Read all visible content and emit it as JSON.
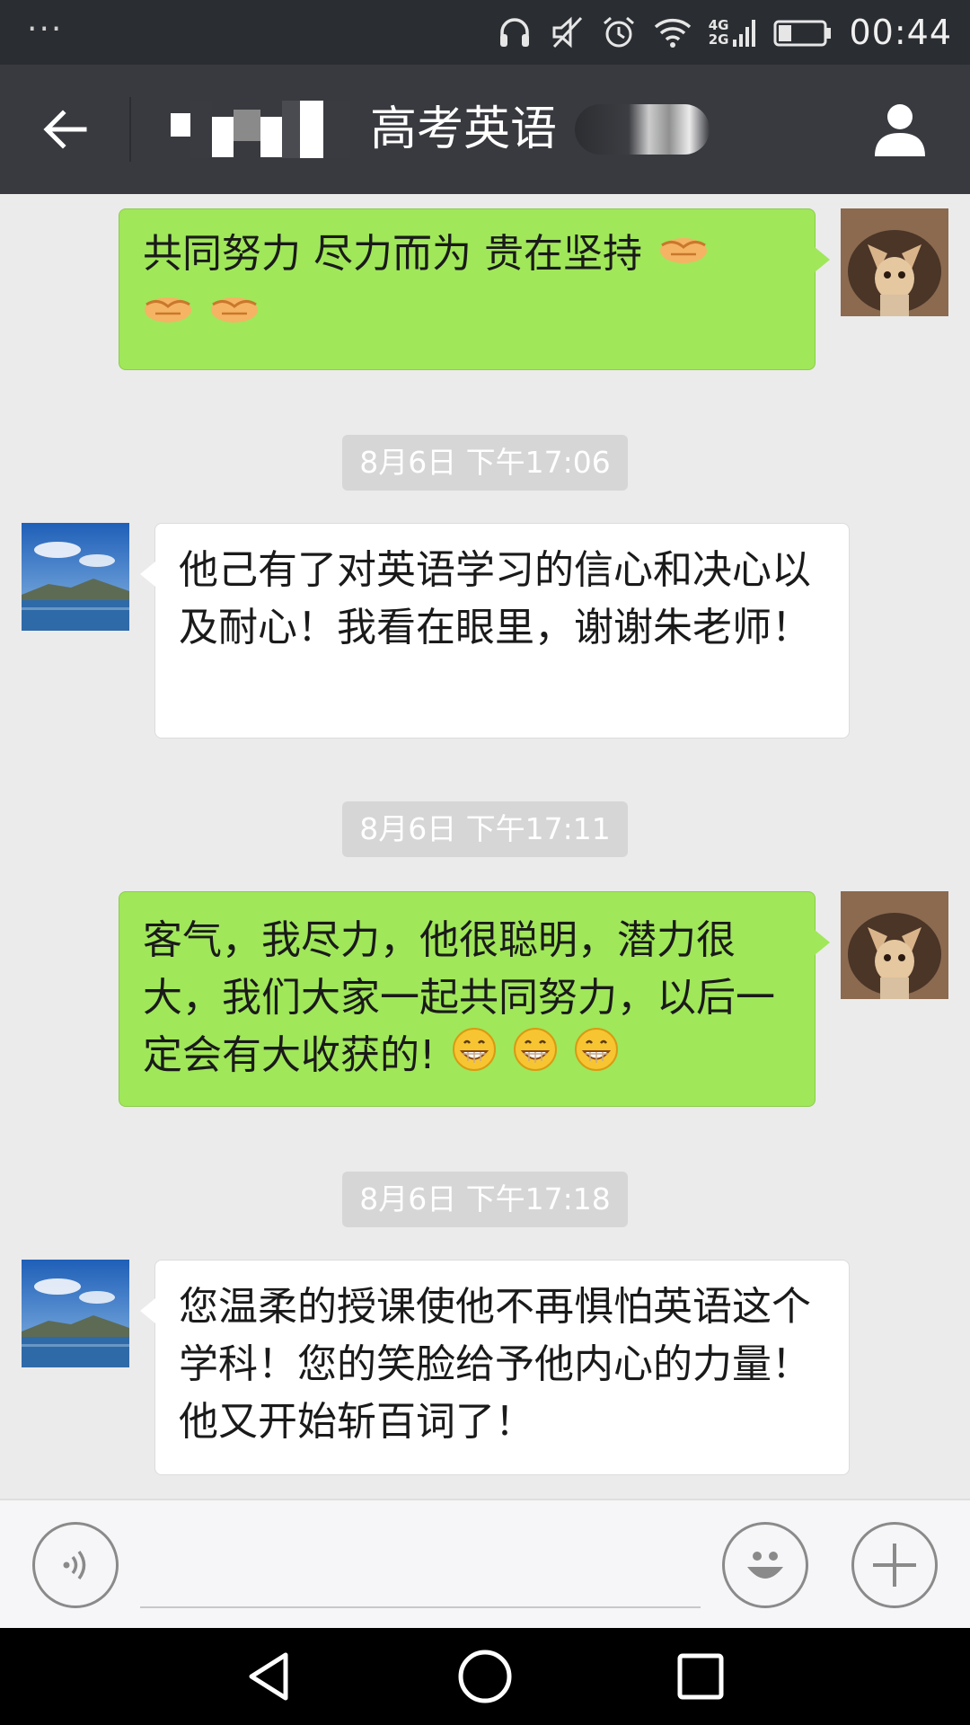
{
  "status_bar": {
    "overflow": "···",
    "net_top": "4G",
    "net_bottom": "2G",
    "time": "00:44",
    "icons": [
      "headphones-icon",
      "mute-icon",
      "alarm-icon",
      "wifi-icon",
      "signal-icon",
      "battery-icon"
    ]
  },
  "header": {
    "title": "高考英语",
    "back_icon": "arrow-left-icon",
    "profile_icon": "person-icon"
  },
  "messages": [
    {
      "side": "sent",
      "text": "共同努力 尽力而为  贵在坚持",
      "emojis": [
        "handshake",
        "handshake",
        "handshake"
      ]
    },
    {
      "side": "time",
      "text": "8月6日 下午17:06"
    },
    {
      "side": "recv",
      "text": "他己有了对英语学习的信心和决心以及耐心！我看在眼里，谢谢朱老师！"
    },
    {
      "side": "time",
      "text": "8月6日 下午17:11"
    },
    {
      "side": "sent",
      "text": "客气，我尽力，他很聪明，潜力很大，我们大家一起共同努力，以后一定会有大收获的!",
      "emojis": [
        "grin",
        "grin",
        "grin"
      ]
    },
    {
      "side": "time",
      "text": "8月6日 下午17:18"
    },
    {
      "side": "recv",
      "text": "您温柔的授课使他不再惧怕英语这个学科！您的笑脸给予他内心的力量！他又开始斩百词了！"
    }
  ],
  "input_bar": {
    "placeholder": "",
    "voice_icon": "voice-icon",
    "emoji_icon": "smiley-icon",
    "plus_icon": "plus-icon"
  },
  "nav_bar": {
    "icons": [
      "back-triangle-icon",
      "home-circle-icon",
      "recents-square-icon"
    ]
  },
  "colors": {
    "sent_bubble": "#a0e75a",
    "recv_bubble": "#ffffff",
    "header_bg": "#393a3f",
    "chat_bg": "#ebebeb"
  }
}
